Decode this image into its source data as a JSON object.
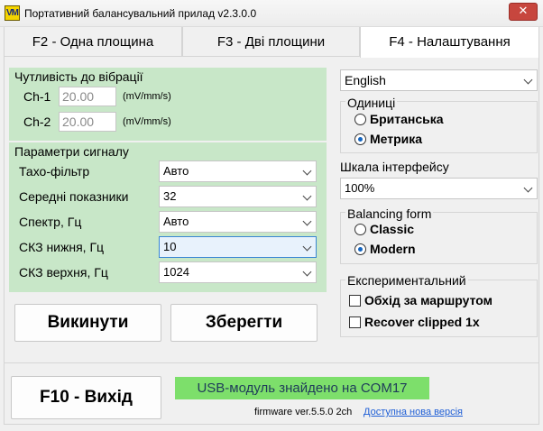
{
  "window": {
    "icon_text": "VM",
    "title": "Портативний балансувальний прилад v2.3.0.0",
    "close_glyph": "✕"
  },
  "tabs": [
    {
      "label": "F2 - Одна площина"
    },
    {
      "label": "F3 - Дві площини"
    },
    {
      "label": "F4 - Налаштування"
    }
  ],
  "sensitivity": {
    "title": "Чутливість до вібрації",
    "channels": [
      {
        "label": "Ch-1",
        "value": "20.00",
        "unit": "(mV/mm/s)"
      },
      {
        "label": "Ch-2",
        "value": "20.00",
        "unit": "(mV/mm/s)"
      }
    ]
  },
  "signal": {
    "title": "Параметри сигналу",
    "rows": [
      {
        "label": "Тахо-фільтр",
        "value": "Авто"
      },
      {
        "label": "Середні показники",
        "value": "32"
      },
      {
        "label": "Спектр, Гц",
        "value": "Авто"
      },
      {
        "label": "СКЗ нижня, Гц",
        "value": "10"
      },
      {
        "label": "СКЗ верхня, Гц",
        "value": "1024"
      }
    ]
  },
  "buttons": {
    "discard": "Викинути",
    "save": "Зберегти",
    "exit": "F10 - Вихід"
  },
  "language": {
    "value": "English"
  },
  "units": {
    "title": "Одиниці",
    "options": [
      {
        "label": "Британська",
        "checked": false
      },
      {
        "label": "Метрика",
        "checked": true
      }
    ]
  },
  "scale": {
    "title": "Шкала інтерфейсу",
    "value": "100%"
  },
  "balancing_form": {
    "title": "Balancing form",
    "options": [
      {
        "label": "Classic",
        "checked": false
      },
      {
        "label": "Modern",
        "checked": true
      }
    ]
  },
  "experimental": {
    "title": "Експериментальний",
    "options": [
      {
        "label": "Обхід за маршрутом",
        "checked": false
      },
      {
        "label": "Recover clipped 1x",
        "checked": false
      }
    ]
  },
  "status": {
    "usb": "USB-модуль знайдено на COM17",
    "firmware": "firmware ver.5.5.0 2ch",
    "update_link": "Доступна нова версія"
  },
  "colors": {
    "panel_green": "#c8e7c8",
    "status_green": "#7ddf6b",
    "radio_dot": "#1565c0",
    "link": "#1f5fd6"
  }
}
